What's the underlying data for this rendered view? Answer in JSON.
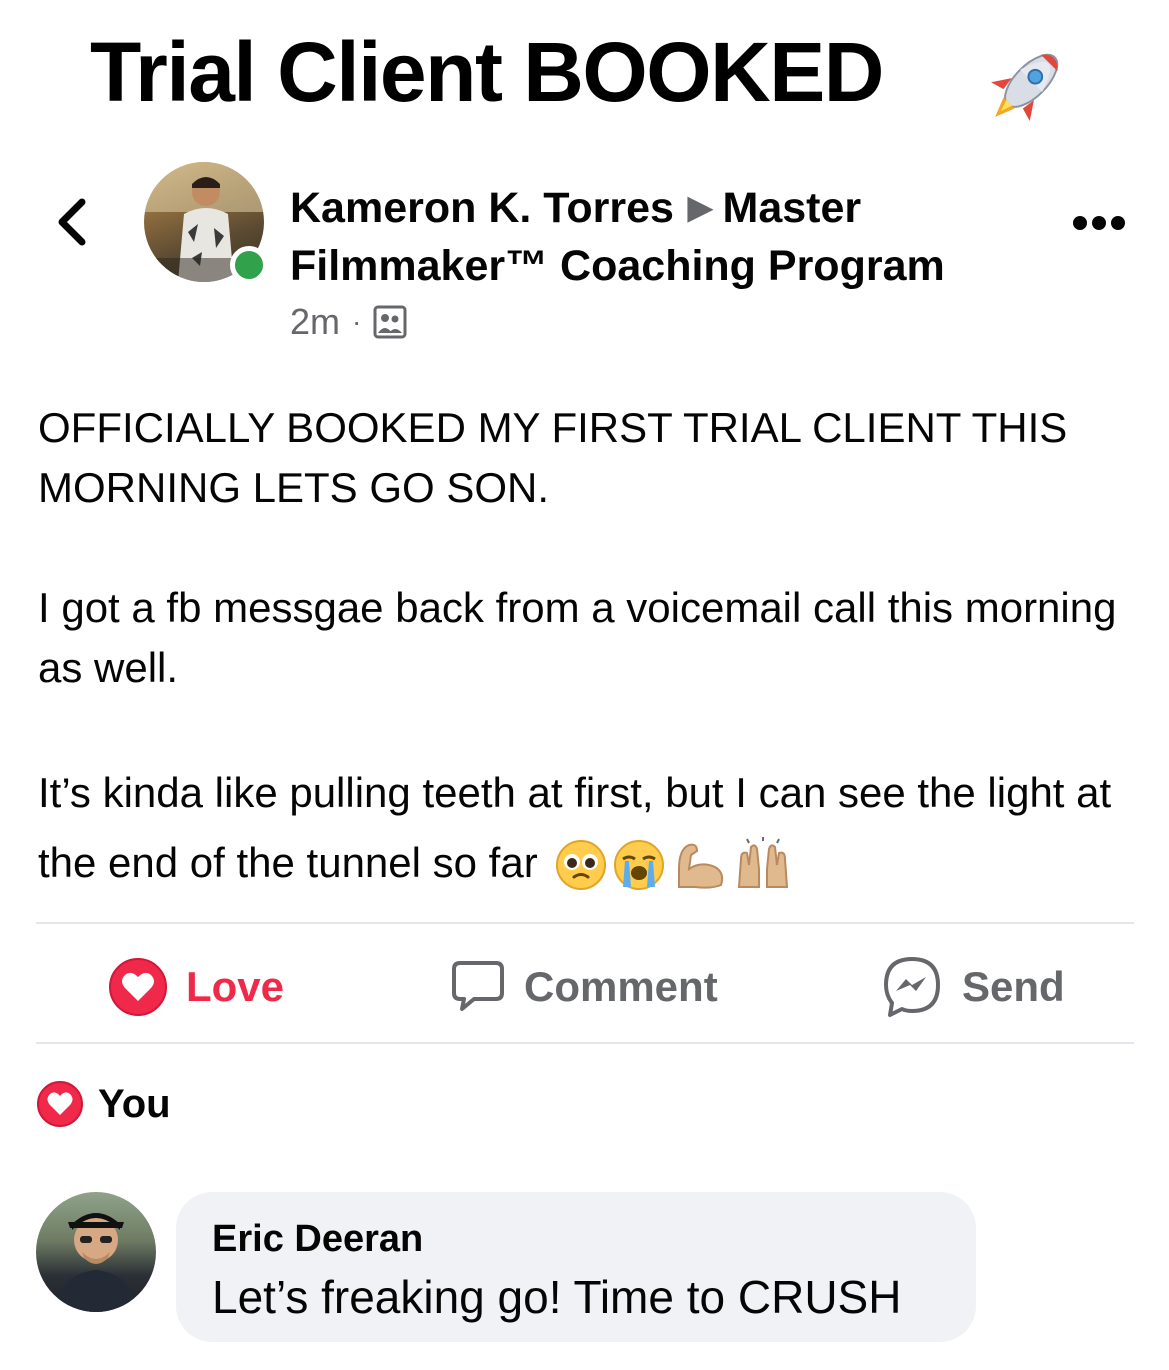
{
  "banner": {
    "title": "Trial Client BOOKED",
    "icon": "rocket-emoji"
  },
  "post": {
    "author": "Kameron K. Torres",
    "group": "Master Filmmaker™ Coaching Program",
    "time": "2m",
    "separator": "·",
    "audience_icon": "group-icon",
    "paragraphs": [
      "OFFICIALLY BOOKED MY FIRST TRIAL CLIENT THIS MORNING LETS GO SON.",
      "I got a fb messgae back from a voicemail call this morning as well.",
      "It’s kinda like pulling teeth at first, but I can see the light at the end of the tunnel so far"
    ],
    "emojis": [
      "pleading-face-emoji",
      "crying-face-emoji",
      "flexed-biceps-emoji",
      "raising-hands-emoji"
    ]
  },
  "actions": {
    "love": "Love",
    "comment": "Comment",
    "send": "Send"
  },
  "reactions": {
    "label": "You"
  },
  "comment": {
    "author": "Eric Deeran",
    "text": "Let’s freaking go! Time to CRUSH"
  },
  "colors": {
    "love_red": "#f0284a",
    "online_green": "#31a24c",
    "secondary_text": "#65676b",
    "bubble_bg": "#f0f2f5"
  }
}
